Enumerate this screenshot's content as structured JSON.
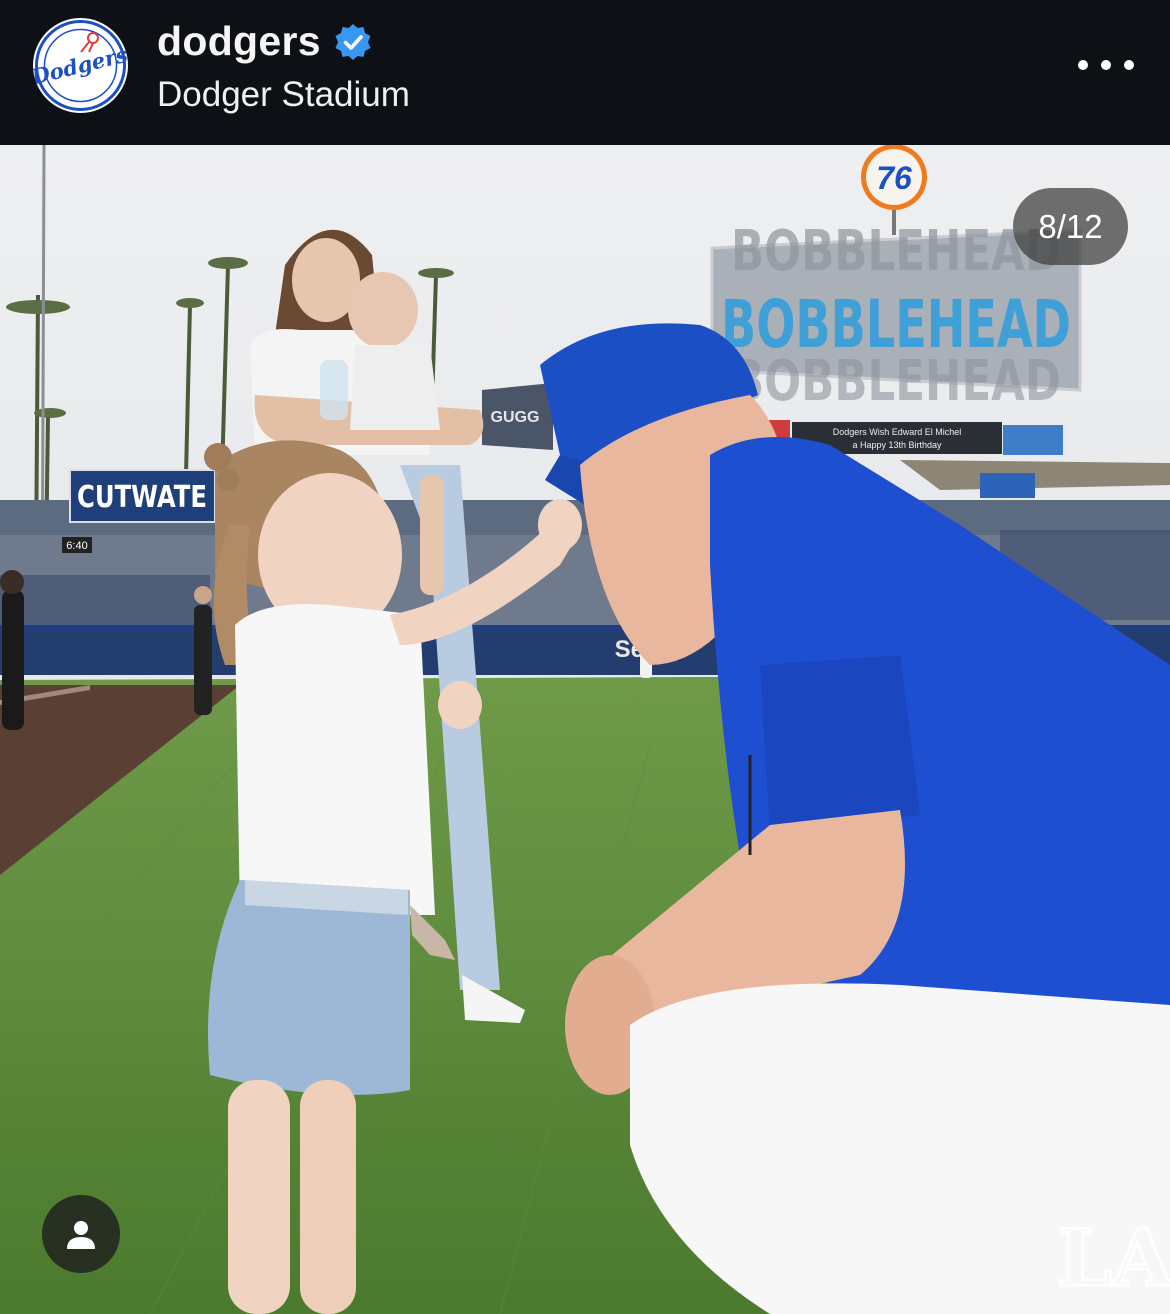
{
  "post": {
    "username": "dodgers",
    "location": "Dodger Stadium",
    "avatar_icon": "dodgers-logo",
    "avatar_text": "Dodgers",
    "verified": true
  },
  "media": {
    "counter": "8/12",
    "current_index": 8,
    "total": 12,
    "tag_icon": "person-icon",
    "scene": {
      "sign_76": "76",
      "bobblehead_sign": "BOBBLEHEAD",
      "cutwater_sign": "CUTWATE",
      "gugg_sign": "GUGG",
      "board_clock": "6:40",
      "scoreboard_line1": "Dodgers Wish Edward El Michel",
      "scoreboard_line2": "a Happy 13th Birthday",
      "outfield_sign": "Select",
      "watermark": "LA"
    }
  },
  "colors": {
    "header_bg": "#0d1014",
    "dodger_blue": "#1d4fc4",
    "verified_blue": "#3897f0",
    "grass": "#5b8c3a"
  }
}
